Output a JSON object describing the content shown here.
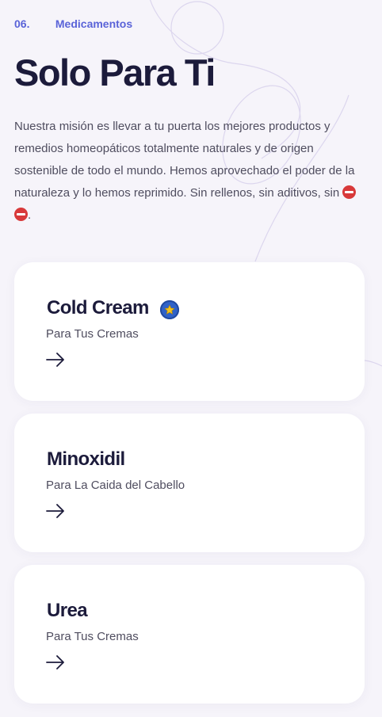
{
  "section": {
    "number": "06.",
    "label": "Medicamentos"
  },
  "title": "Solo Para Ti",
  "description": "Nuestra misión es llevar a tu puerta los mejores productos y remedios homeopáticos totalmente naturales y de origen sostenible de todo el mundo. Hemos aprovechado el poder de la naturaleza y lo hemos reprimido. Sin rellenos, sin aditivos, sin",
  "description_end": ".",
  "cards": [
    {
      "title": "Cold Cream",
      "subtitle": "Para Tus Cremas",
      "badge_icon": "star-badge-icon"
    },
    {
      "title": "Minoxidil",
      "subtitle": "Para La Caida del Cabello"
    },
    {
      "title": "Urea",
      "subtitle": "Para Tus Cremas"
    }
  ],
  "colors": {
    "accent": "#5a63d8",
    "heading": "#1c1b3b",
    "background": "#f6f4fa",
    "card": "#ffffff"
  }
}
